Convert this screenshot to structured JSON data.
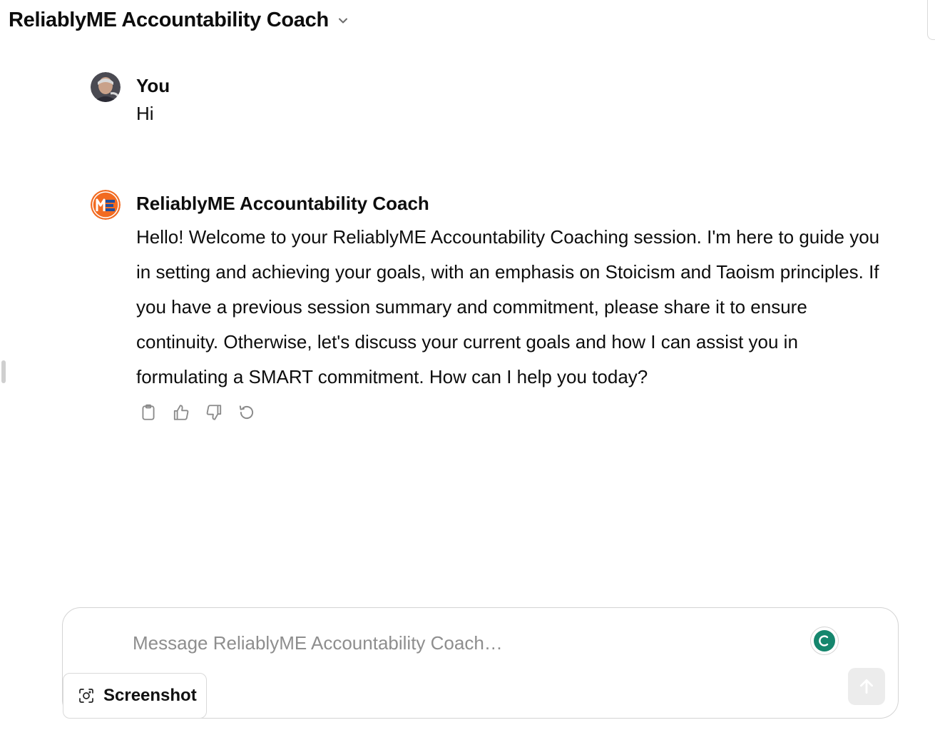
{
  "header": {
    "title": "ReliablyME Accountability Coach",
    "chevron_icon": "chevron-down-icon"
  },
  "conversation": {
    "user_message": {
      "author": "You",
      "text": "Hi"
    },
    "assistant_message": {
      "author": "ReliablyME Accountability Coach",
      "text": "Hello! Welcome to your ReliablyME Accountability Coaching session. I'm here to guide you in setting and achieving your goals, with an emphasis on Stoicism and Taoism principles. If you have a previous session summary and commitment, please share it to ensure continuity. Otherwise, let's discuss your current goals and how I can assist you in formulating a SMART commitment. How can I help you today?",
      "actions": [
        "copy-icon",
        "thumbs-up-icon",
        "thumbs-down-icon",
        "regenerate-icon"
      ]
    }
  },
  "composer": {
    "placeholder": "Message ReliablyME Accountability Coach…",
    "send_icon": "arrow-up-icon"
  },
  "screenshot_button": {
    "label": "Screenshot",
    "icon": "camera-icon"
  },
  "colors": {
    "assistant_avatar_bg": "#f26b21",
    "grammar_green": "#15866d",
    "send_disabled_bg": "#ececec"
  }
}
